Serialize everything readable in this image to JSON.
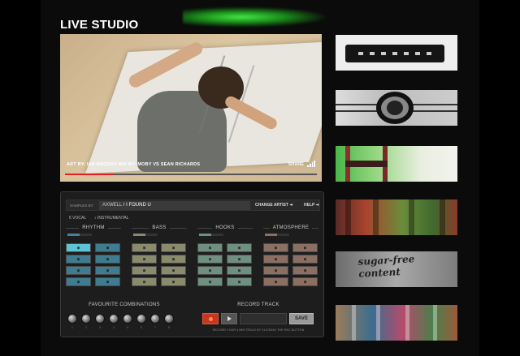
{
  "header": {
    "title": "LIVE STUDIO"
  },
  "video": {
    "caption": "ART BY: IAN BROOKS MIX BY: MOBY VS SEAN RICHARDS",
    "share_label": "SHARE",
    "progress": 0.19
  },
  "thumbnails": [
    {
      "id": "thumb-1"
    },
    {
      "id": "thumb-2"
    },
    {
      "id": "thumb-3"
    },
    {
      "id": "thumb-4"
    },
    {
      "id": "thumb-5",
      "text": "sugar-free\ncontent"
    },
    {
      "id": "thumb-6"
    }
  ],
  "mixer": {
    "samples_label": "SAMPLES BY:",
    "artist": "AXWELL",
    "track": "/ I FOUND U",
    "change_artist": "CHANGE ARTIST ➜",
    "help": "HELP ➜",
    "vocal_label": "VOCAL",
    "instrumental_label": "INSTRUMENTAL",
    "columns": [
      {
        "name": "RHYTHM",
        "meter": 0.5,
        "meter_color": "#4a7fa0",
        "pad_color": "#3f7c8f",
        "active_color": "#5fc3d6"
      },
      {
        "name": "BASS",
        "meter": 0.5,
        "meter_color": "#8a8a70",
        "pad_color": "#8a8a6c",
        "active_color": "#8a8a6c"
      },
      {
        "name": "HOOKS",
        "meter": 0.5,
        "meter_color": "#6f8f7f",
        "pad_color": "#6f8f80",
        "active_color": "#6f8f80"
      },
      {
        "name": "ATMOSPHERE",
        "meter": 0.5,
        "meter_color": "#8a6f62",
        "pad_color": "#8a6f62",
        "active_color": "#8a6f62"
      }
    ],
    "favourite_title": "FAVOURITE COMBINATIONS",
    "favourite_numbers": [
      "1",
      "2",
      "3",
      "4",
      "5",
      "6",
      "7",
      "8"
    ],
    "record_title": "RECORD TRACK",
    "save_label": "SAVE",
    "record_note": "RECORD YOUR 4 MIN TRACK BY CLICKING THE REC BUTTON"
  }
}
